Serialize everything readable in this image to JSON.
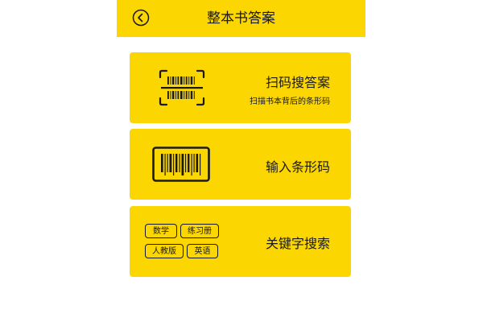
{
  "header": {
    "title": "整本书答案",
    "back_icon": "back-arrow-circle-icon"
  },
  "cards": {
    "scan": {
      "title": "扫码搜答案",
      "subtitle": "扫描书本背后的条形码",
      "icon": "barcode-scan-icon"
    },
    "input": {
      "title": "输入条形码",
      "icon": "barcode-icon"
    },
    "keyword": {
      "title": "关键字搜索",
      "tags": [
        "数学",
        "练习册",
        "人教版",
        "英语"
      ]
    }
  },
  "colors": {
    "accent": "#fbd601",
    "text": "#1a1a1a",
    "background": "#ffffff"
  }
}
